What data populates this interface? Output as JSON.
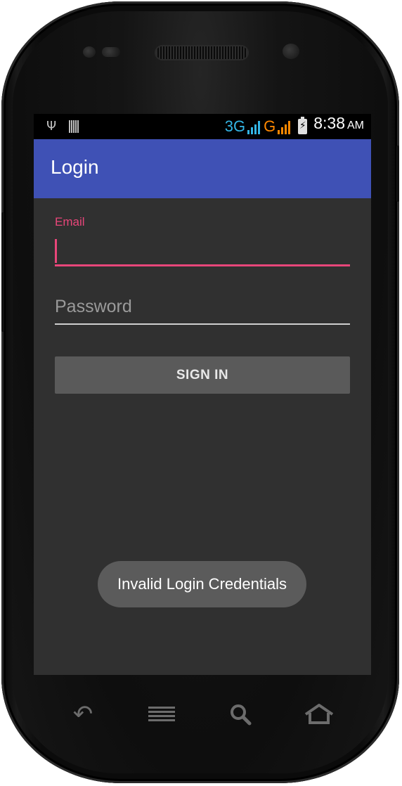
{
  "status_bar": {
    "network_3g": "3G",
    "network_g": "G",
    "time": "8:38",
    "ampm": "AM",
    "colors": {
      "net_3g": "#33b5e5",
      "net_g": "#ff8800"
    },
    "icons": [
      "usb-icon",
      "sim-card-icon",
      "signal-icon",
      "battery-charging-icon"
    ]
  },
  "app_bar": {
    "title": "Login",
    "color": "#3f51b5"
  },
  "form": {
    "email_label": "Email",
    "email_value": "",
    "password_placeholder": "Password",
    "password_value": "",
    "sign_in_label": "SIGN IN",
    "accent_color": "#e8467a"
  },
  "toast": {
    "message": "Invalid Login Credentials"
  },
  "nav_keys": {
    "icons": [
      "back-icon",
      "menu-icon",
      "search-icon",
      "home-icon"
    ]
  }
}
